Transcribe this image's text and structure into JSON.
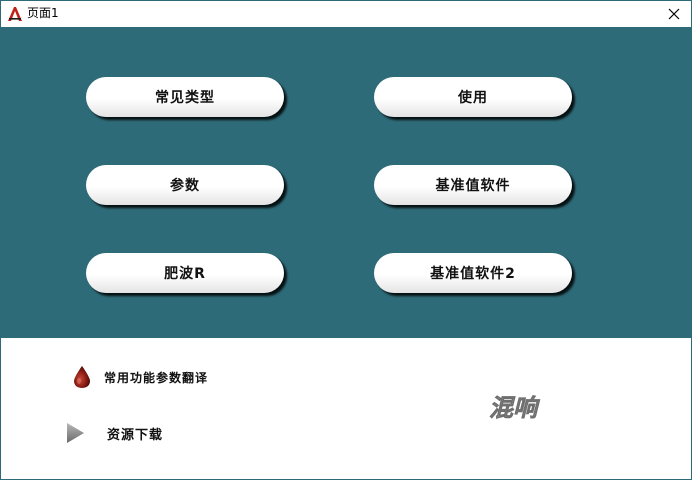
{
  "window": {
    "title": "页面1",
    "close_symbol": "✕",
    "accent_color": "#2e6b78"
  },
  "buttons": [
    {
      "label": "常见类型"
    },
    {
      "label": "使用"
    },
    {
      "label": "参数"
    },
    {
      "label": "基准值软件"
    },
    {
      "label": "肥波R"
    },
    {
      "label": "基准值软件2"
    }
  ],
  "links": [
    {
      "label": "常用功能参数翻译",
      "icon": "blood-drop-icon"
    },
    {
      "label": "资源下载",
      "icon": "play-arrow-icon"
    }
  ],
  "watermark": {
    "text": "混响"
  }
}
